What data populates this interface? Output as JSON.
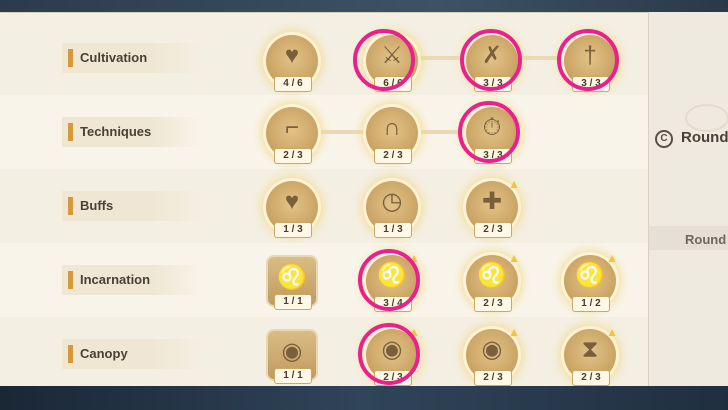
{
  "rows": [
    {
      "label": "Cultivation",
      "nodes": [
        {
          "icon": "heart-icon",
          "count": "4 / 6"
        },
        {
          "icon": "sword-arrows-icon",
          "count": "6 / 6"
        },
        {
          "icon": "crossed-axe-icon",
          "count": "3 / 3"
        },
        {
          "icon": "triple-sword-icon",
          "count": "3 / 3"
        }
      ]
    },
    {
      "label": "Techniques",
      "nodes": [
        {
          "icon": "boot-icon",
          "count": "2 / 3"
        },
        {
          "icon": "magnet-icon",
          "count": "2 / 3"
        },
        {
          "icon": "stopwatch-icon",
          "count": "3 / 3"
        }
      ]
    },
    {
      "label": "Buffs",
      "nodes": [
        {
          "icon": "heart-plus-icon",
          "count": "1 / 3"
        },
        {
          "icon": "clock-plus-icon",
          "count": "1 / 3"
        },
        {
          "icon": "sword-plus-icon",
          "count": "2 / 3"
        }
      ]
    },
    {
      "label": "Incarnation",
      "nodes": [
        {
          "icon": "lion-icon",
          "count": "1 / 1"
        },
        {
          "icon": "lion-clock-icon",
          "count": "3 / 4"
        },
        {
          "icon": "lion-shield-icon",
          "count": "2 / 3"
        },
        {
          "icon": "lion-plus-icon",
          "count": "1 / 2"
        }
      ]
    },
    {
      "label": "Canopy",
      "nodes": [
        {
          "icon": "orb-icon",
          "count": "1 / 1"
        },
        {
          "icon": "orb-clock-icon",
          "count": "2 / 3"
        },
        {
          "icon": "orb-shield-icon",
          "count": "2 / 3"
        },
        {
          "icon": "orb-hourglass-icon",
          "count": "2 / 3"
        }
      ]
    }
  ],
  "side": {
    "round_label": "Round",
    "round_label_2": "Round"
  },
  "colors": {
    "highlight": "#e8218c",
    "accent": "#d49a3a",
    "upgrade": "#f0c43b"
  }
}
